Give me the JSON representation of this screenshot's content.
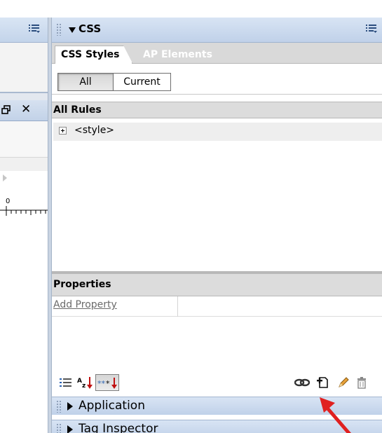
{
  "css_panel": {
    "title": "CSS",
    "tabs": [
      {
        "label": "CSS Styles",
        "active": true
      },
      {
        "label": "AP Elements",
        "active": false
      }
    ],
    "view_toggle": {
      "all_label": "All",
      "current_label": "Current",
      "selected": "All"
    },
    "all_rules": {
      "header": "All Rules",
      "items": [
        {
          "label": "<style>",
          "expanded": false
        }
      ]
    },
    "properties": {
      "header": "Properties",
      "add_property_label": "Add Property"
    },
    "toolbar": {
      "left_icons": [
        "category-view-icon",
        "alphabetical-view-icon",
        "show-set-properties-icon"
      ],
      "right_icons": [
        "attach-stylesheet-icon",
        "new-css-rule-icon",
        "edit-style-icon",
        "delete-icon"
      ]
    }
  },
  "collapsed_panels": [
    {
      "title": "Application"
    },
    {
      "title": "Tag Inspector"
    }
  ],
  "left_panel": {
    "ruler_label": "0"
  },
  "colors": {
    "panel_header": "#c8d7ec",
    "annotation_arrow": "#e02020"
  }
}
